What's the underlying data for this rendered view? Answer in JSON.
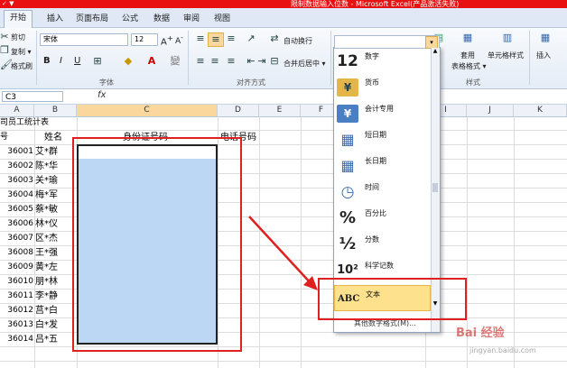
{
  "window": {
    "title": "限制数据输入位数 - Microsoft Excel(产品激活失败)",
    "quick_access": "✓ ▼"
  },
  "tabs": [
    {
      "label": "开始"
    },
    {
      "label": "插入"
    },
    {
      "label": "页面布局"
    },
    {
      "label": "公式"
    },
    {
      "label": "数据"
    },
    {
      "label": "审阅"
    },
    {
      "label": "视图"
    }
  ],
  "ribbon": {
    "clipboard": {
      "cut": "剪切",
      "copy": "复制 ▾",
      "format_painter": "格式刷"
    },
    "font": {
      "name": "宋体",
      "size": "12",
      "group_label": "字体",
      "bold": "B",
      "italic": "I",
      "underline": "U"
    },
    "alignment": {
      "wrap_text": "自动换行",
      "merge_center": "合并后居中 ▾",
      "group_label": "对齐方式"
    },
    "styles": {
      "table_format": "套用",
      "table_format2": "表格格式 ▾",
      "cell_styles": "单元格样式",
      "group_label": "样式"
    },
    "cells": {
      "insert": "插入"
    }
  },
  "formula_bar": {
    "name_box": "C3",
    "fx": "fx",
    "content": ""
  },
  "columns": [
    "A",
    "B",
    "C",
    "D",
    "E",
    "F",
    "G",
    "H",
    "I",
    "J",
    "K"
  ],
  "selected_column": "C",
  "sheet": {
    "title": "司员工统计表",
    "headers": {
      "a": "号",
      "b": "姓名",
      "c": "身份证号码",
      "d": "电话号码"
    },
    "rows": [
      {
        "id": "36001",
        "name": "艾*群"
      },
      {
        "id": "36002",
        "name": "陈*华"
      },
      {
        "id": "36003",
        "name": "关*瑜"
      },
      {
        "id": "36004",
        "name": "梅*军"
      },
      {
        "id": "36005",
        "name": "蔡*敏"
      },
      {
        "id": "36006",
        "name": "林*仪"
      },
      {
        "id": "36007",
        "name": "区*杰"
      },
      {
        "id": "36008",
        "name": "王*强"
      },
      {
        "id": "36009",
        "name": "黄*左"
      },
      {
        "id": "36010",
        "name": "朋*林"
      },
      {
        "id": "36011",
        "name": "李*静"
      },
      {
        "id": "36012",
        "name": "莒*白"
      },
      {
        "id": "36013",
        "name": "白*发"
      },
      {
        "id": "36014",
        "name": "吕*五"
      }
    ]
  },
  "number_format_menu": {
    "items": [
      {
        "glyph": "12",
        "label": "数字",
        "icon": "number-icon"
      },
      {
        "glyph": "¥",
        "label": "货币",
        "icon": "currency-icon"
      },
      {
        "glyph": "¥",
        "label": "会计专用",
        "icon": "accounting-icon"
      },
      {
        "glyph": "▦",
        "label": "短日期",
        "icon": "calendar-icon"
      },
      {
        "glyph": "▦",
        "label": "长日期",
        "icon": "calendar-icon"
      },
      {
        "glyph": "◷",
        "label": "时间",
        "icon": "clock-icon"
      },
      {
        "glyph": "%",
        "label": "百分比",
        "icon": "percent-icon"
      },
      {
        "glyph": "½",
        "label": "分数",
        "icon": "fraction-icon"
      },
      {
        "glyph": "10²",
        "label": "科学记数",
        "icon": "scientific-icon"
      },
      {
        "glyph": "ABC",
        "label": "文本",
        "icon": "text-icon"
      }
    ],
    "highlighted": "文本",
    "more": "其他数字格式(M)..."
  },
  "watermark": {
    "brand": "Bai 经验",
    "url": "jingyan.baidu.com"
  },
  "colors": {
    "accent": "#e81010",
    "highlight": "#fde18c",
    "selection": "#bcd7f3",
    "annotation": "#e02020"
  }
}
